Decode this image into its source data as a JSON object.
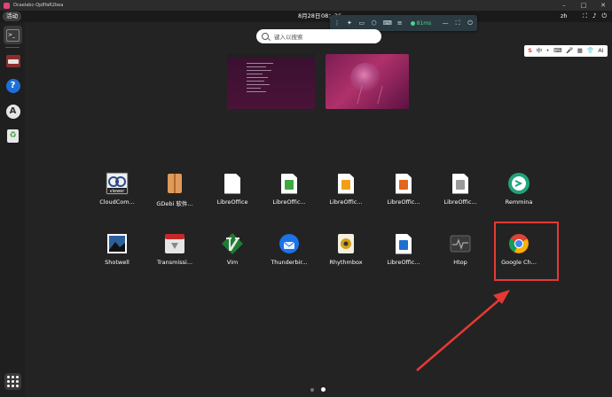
{
  "window": {
    "title": "Ocaelabc-Qp8faR2bea"
  },
  "panel": {
    "activities": "活动",
    "date": "8月28日",
    "time": "08：36",
    "lang": "zh"
  },
  "remote_toolbar": {
    "latency": "81ms"
  },
  "search": {
    "placeholder": "键入以搜索"
  },
  "ime": {
    "items": [
      "中",
      "•",
      "⌨",
      "🎤",
      "▦",
      "👕",
      "AI"
    ]
  },
  "dock": {
    "items": [
      "terminal",
      "files",
      "help",
      "software-updater",
      "trash"
    ]
  },
  "apps": [
    {
      "label": "CloudCom...",
      "icon": "cloudcompare-icon"
    },
    {
      "label": "GDebi 软件...",
      "icon": "gdebi-icon"
    },
    {
      "label": "LibreOffice",
      "icon": "libreoffice-icon"
    },
    {
      "label": "LibreOffic...",
      "icon": "libreoffice-calc-icon"
    },
    {
      "label": "LibreOffic...",
      "icon": "libreoffice-draw-icon"
    },
    {
      "label": "LibreOffic...",
      "icon": "libreoffice-impress-icon"
    },
    {
      "label": "LibreOffic...",
      "icon": "libreoffice-math-icon"
    },
    {
      "label": "Remmina",
      "icon": "remmina-icon"
    },
    {
      "label": "Shotwell",
      "icon": "shotwell-icon"
    },
    {
      "label": "Transmissi...",
      "icon": "transmission-icon"
    },
    {
      "label": "Vim",
      "icon": "vim-icon"
    },
    {
      "label": "Thunderbir...",
      "icon": "thunderbird-icon"
    },
    {
      "label": "Rhythmbox",
      "icon": "rhythmbox-icon"
    },
    {
      "label": "LibreOffic...",
      "icon": "libreoffice-writer-icon"
    },
    {
      "label": "Htop",
      "icon": "htop-icon"
    },
    {
      "label": "Google Ch...",
      "icon": "google-chrome-icon"
    }
  ],
  "colors": {
    "highlight": "#e53935",
    "background": "#232323"
  }
}
